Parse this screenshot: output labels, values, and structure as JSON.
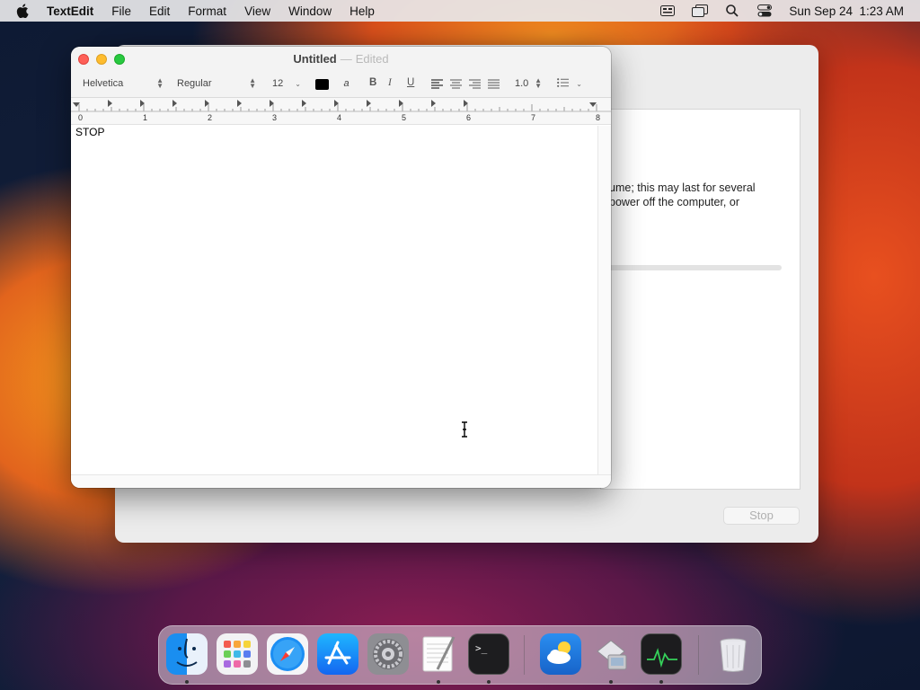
{
  "menubar": {
    "app_name": "TextEdit",
    "items": [
      "File",
      "Edit",
      "Format",
      "View",
      "Window",
      "Help"
    ],
    "clock": "Sun Sep 24  1:23 AM",
    "status_icons": [
      "keyboard-input-icon",
      "screen-mirroring-icon",
      "spotlight-search-icon",
      "control-center-icon"
    ]
  },
  "background_window": {
    "message_line1": "ume; this may last for several",
    "message_line2": "power off the computer, or",
    "stop_label": "Stop"
  },
  "textedit": {
    "title": "Untitled",
    "separator": "—",
    "edited": "Edited",
    "font_family": "Helvetica",
    "font_style": "Regular",
    "font_size": "12",
    "line_spacing": "1.0",
    "bold": "B",
    "italic": "I",
    "underline": "U",
    "highlight": "a",
    "ruler_numbers": [
      "0",
      "1",
      "2",
      "3",
      "4",
      "5",
      "6",
      "7",
      "8"
    ],
    "document_text": "STOP"
  },
  "dock": {
    "apps": [
      "Finder",
      "Launchpad",
      "Safari",
      "App Store",
      "System Settings",
      "TextEdit",
      "Terminal",
      "Weather",
      "Boot Camp Assistant",
      "Activity Monitor",
      "Trash"
    ]
  },
  "colors": {
    "close": "#fe5f57",
    "minimize": "#febc2e",
    "zoom": "#28c840"
  }
}
